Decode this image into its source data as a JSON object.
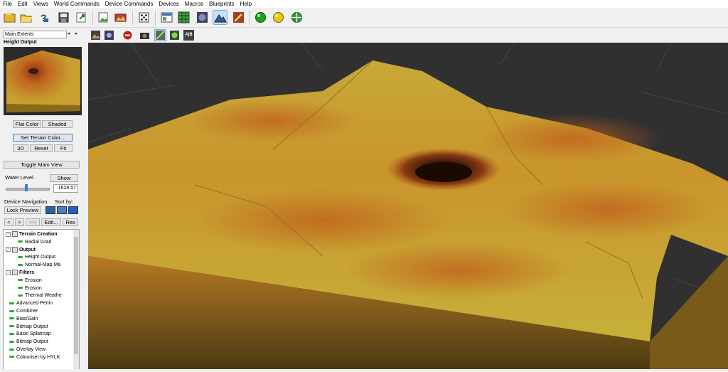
{
  "menu": [
    "File",
    "Edit",
    "Views",
    "World Commands",
    "Device Commands",
    "Devices",
    "Macros",
    "Blueprints",
    "Help"
  ],
  "toolbar": {
    "icons": [
      "new-project-icon",
      "open-project-icon",
      "help-icon",
      "save-icon",
      "export-icon",
      "import-icon",
      "image-icon",
      "dice-icon",
      "layout-icon",
      "grid-icon",
      "world-icon",
      "mountain-icon",
      "brush-icon",
      "green-ball-icon",
      "yellow-ball-icon",
      "globe-icon"
    ]
  },
  "left_panel": {
    "extents_label": "Main Extents",
    "preview_title": "Height Output",
    "flat_color": "Flat Color",
    "shaded": "Shaded",
    "set_terrain_color": "Set Terrain Color...",
    "btn_3d": "3D",
    "reset": "Reset",
    "fit": "Fit",
    "toggle_main_view": "Toggle Main View",
    "water_level_label": "Water Level",
    "show": "Show",
    "water_level_value": "1628.57",
    "device_navigation": "Device Navigation",
    "sort_by": "Sort by:",
    "lock_preview": "Lock Preview",
    "edit": "Edit...",
    "res": "Res",
    "nav_prev": "<",
    "nav_next": ">",
    "nav_last": ">>|"
  },
  "device_tree": [
    {
      "label": "Terrain Creation",
      "level": 0,
      "group": true
    },
    {
      "label": "Radial Grad",
      "level": 1,
      "group": false
    },
    {
      "label": "Output",
      "level": 0,
      "group": true
    },
    {
      "label": "Height Output",
      "level": 1,
      "group": false
    },
    {
      "label": "Normal-Map Ma",
      "level": 1,
      "group": false
    },
    {
      "label": "Filters",
      "level": 0,
      "group": true
    },
    {
      "label": "Erosion",
      "level": 1,
      "group": false
    },
    {
      "label": "Erosion",
      "level": 1,
      "group": false
    },
    {
      "label": "Thermal Weathe",
      "level": 1,
      "group": false
    },
    {
      "label": "Advanced Perlin",
      "level": -1,
      "group": false
    },
    {
      "label": "Combiner",
      "level": -1,
      "group": false
    },
    {
      "label": "Bias/Gain",
      "level": -1,
      "group": false
    },
    {
      "label": "Bitmap Output",
      "level": -1,
      "group": false
    },
    {
      "label": "Basic Splatmap",
      "level": -1,
      "group": false
    },
    {
      "label": "Bitmap Output",
      "level": -1,
      "group": false
    },
    {
      "label": "Overlay View",
      "level": -1,
      "group": false
    },
    {
      "label": "Colouriser by HYLK",
      "level": -1,
      "group": false
    }
  ],
  "viewport_toolbar": {
    "icons": [
      "render-icon",
      "render-settings-icon",
      "stop-icon",
      "camera-icon",
      "wireframe-icon",
      "shaded-icon",
      "ab-compare-icon"
    ],
    "ab_label": "A|B"
  },
  "colors": {
    "terrain_light": "#c6b53a",
    "terrain_mid": "#c98a28",
    "terrain_dark": "#b45a1c",
    "viewport_bg": "#303030",
    "crater": "#3a1a0a"
  }
}
